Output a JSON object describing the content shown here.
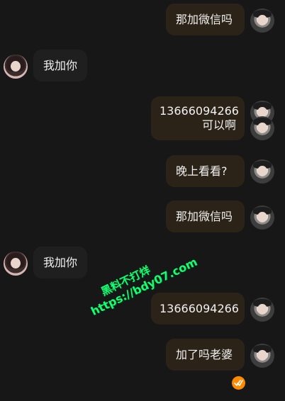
{
  "messages": [
    {
      "side": "right",
      "lines": [
        "那加微信吗"
      ]
    },
    {
      "side": "left",
      "lines": [
        "我加你"
      ]
    },
    {
      "side": "right",
      "lines": [
        "13666094266",
        "可以啊"
      ]
    },
    {
      "side": "right",
      "lines": [
        "晚上看看?"
      ]
    },
    {
      "side": "right",
      "lines": [
        "那加微信吗"
      ]
    },
    {
      "side": "left",
      "lines": [
        "我加你"
      ]
    },
    {
      "side": "right",
      "lines": [
        "13666094266"
      ]
    },
    {
      "side": "right",
      "lines": [
        "加了吗老婆"
      ]
    }
  ],
  "watermark": {
    "line1": "黑料不打烊",
    "line2": "https://bdy07.com"
  },
  "status": {
    "icon": "double-check-icon",
    "color": "#ff8a00"
  },
  "colors": {
    "background": "#171717",
    "sent_bubble": "#2b2218",
    "received_bubble": "#1f1f1f",
    "text": "#f1f1f1"
  }
}
